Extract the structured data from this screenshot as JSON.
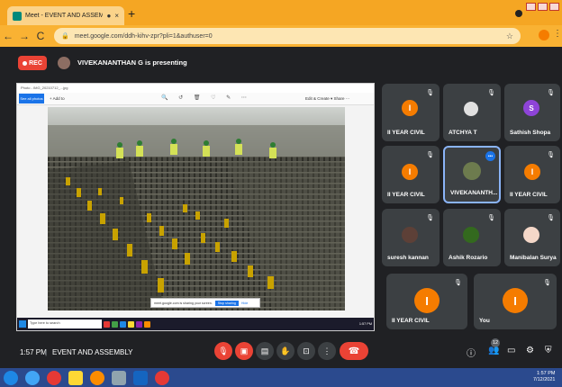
{
  "browser": {
    "tab_title": "Meet - EVENT AND ASSEMB",
    "tab_indicator": "●",
    "tab_close": "×",
    "new_tab": "+",
    "back": "←",
    "forward": "→",
    "reload": "C",
    "lock": "🔒",
    "url": "meet.google.com/ddh-kihv-zpr?pli=1&authuser=0",
    "bookmark_star": "☆",
    "menu": "⋮"
  },
  "meet": {
    "rec_label": "REC",
    "presenter_text": "VIVEKANANTHAN G is presenting",
    "time": "1:57 PM",
    "separator": "|",
    "meeting_name": "EVENT AND ASSEMBLY",
    "people_count": "12"
  },
  "shared_screen": {
    "window_title": "Photo - IMG_20210712_...jpg",
    "see_all_photos": "See all photos",
    "add_to": "+ Add to",
    "tool_icons": "🔍 ↺ 🗑 ♡ ✎ ⋯",
    "edit_create": "Edit & Create ▾  Share  ⋯",
    "share_notice": "meet.google.com is sharing your screen.",
    "stop_sharing": "Stop sharing",
    "hide": "Hide",
    "taskbar_search": "Type here to search",
    "taskbar_clock": "1:57 PM"
  },
  "tiles": [
    {
      "label": "II YEAR CIVIL",
      "initial": "I",
      "color": "#f57c00"
    },
    {
      "label": "ATCHYA T",
      "initial": "",
      "color": "#e0e0e0"
    },
    {
      "label": "Sathish Shopa",
      "initial": "S",
      "color": "#8e44d8"
    },
    {
      "label": "II YEAR CIVIL",
      "initial": "I",
      "color": "#f57c00"
    },
    {
      "label": "VIVEKANANTH...",
      "initial": "",
      "color": "#6d7b4e"
    },
    {
      "label": "II YEAR CIVIL",
      "initial": "I",
      "color": "#f57c00"
    },
    {
      "label": "suresh kannan",
      "initial": "",
      "color": "#5d4037"
    },
    {
      "label": "Ashik Rozario",
      "initial": "",
      "color": "#33691e"
    },
    {
      "label": "Manibalan Surya",
      "initial": "",
      "color": "#f4d7c8"
    },
    {
      "label": "II YEAR CIVIL",
      "initial": "I",
      "color": "#f57c00"
    },
    {
      "label": "You",
      "initial": "I",
      "color": "#f57c00"
    }
  ],
  "host_taskbar": {
    "clock_time": "1:57 PM",
    "clock_date": "7/12/2021"
  },
  "colors": {
    "browser_tab_bar": "#f5a623",
    "meet_bg": "#202124",
    "tile_bg": "#3c4043",
    "danger": "#ea4335",
    "accent": "#1a73e8"
  }
}
